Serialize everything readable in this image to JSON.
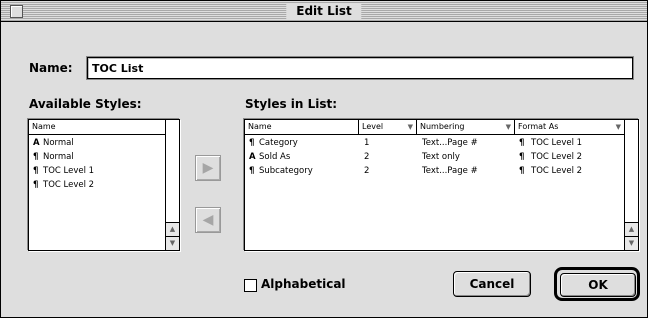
{
  "window": {
    "title": "Edit List"
  },
  "name_field": {
    "label": "Name:",
    "value": "TOC List"
  },
  "available_styles": {
    "heading": "Available Styles:",
    "column": "Name",
    "items": [
      {
        "icon": "character-style-icon",
        "glyph": "A",
        "label": "Normal"
      },
      {
        "icon": "paragraph-style-icon",
        "glyph": "¶",
        "label": "Normal"
      },
      {
        "icon": "paragraph-style-icon",
        "glyph": "¶",
        "label": "TOC Level 1"
      },
      {
        "icon": "paragraph-style-icon",
        "glyph": "¶",
        "label": "TOC Level 2"
      }
    ]
  },
  "styles_in_list": {
    "heading": "Styles in List:",
    "columns": [
      "Name",
      "Level",
      "Numbering",
      "Format As"
    ],
    "rows": [
      {
        "icon": "paragraph-style-icon",
        "glyph": "¶",
        "name": "Category",
        "level": "1",
        "numbering": "Text...Page #",
        "format_glyph": "¶",
        "format_as": "TOC Level 1"
      },
      {
        "icon": "character-style-icon",
        "glyph": "A",
        "name": "Sold As",
        "level": "2",
        "numbering": "Text only",
        "format_glyph": "¶",
        "format_as": "TOC Level 2"
      },
      {
        "icon": "paragraph-style-icon",
        "glyph": "¶",
        "name": "Subcategory",
        "level": "2",
        "numbering": "Text...Page #",
        "format_glyph": "¶",
        "format_as": "TOC Level 2"
      }
    ]
  },
  "controls": {
    "alphabetical_label": "Alphabetical",
    "alphabetical_checked": false,
    "cancel_label": "Cancel",
    "ok_label": "OK",
    "add_arrow": "▶",
    "remove_arrow": "◀",
    "scroll_up": "▲",
    "scroll_down": "▼",
    "dropdown": "▼"
  }
}
